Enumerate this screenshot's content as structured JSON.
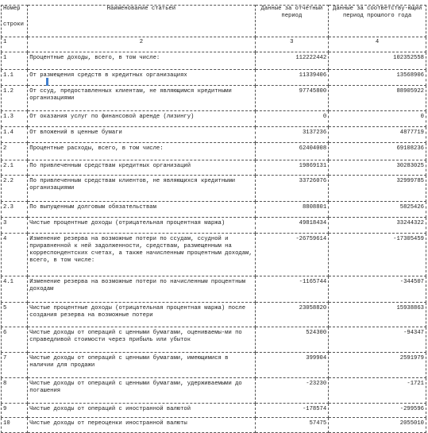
{
  "header": {
    "col1_top": "Номер",
    "col1_bottom": "строки",
    "col2": "Наименование статьей",
    "col3": "Данные за отчетный период",
    "col4": "Данные за соответству-ющий период прошлого года"
  },
  "column_numbers": [
    "1",
    "2",
    "3",
    "4"
  ],
  "rows": [
    {
      "num": "1",
      "name": "Процентные доходы, всего, в том числе:",
      "current": "112222442",
      "previous": "102352558"
    },
    {
      "num": "1.1",
      "name": "От размещения средств в кредитных организациях",
      "current": "11339406",
      "previous": "13568906"
    },
    {
      "num": "1.2",
      "name": "От ссуд, предоставленных клиентам, не являющимся кредитными организациями",
      "current": "97745800",
      "previous": "88905922"
    },
    {
      "num": "1.3",
      "name": "От оказания услуг по финансовой аренде (лизингу)",
      "current": "0",
      "previous": "0"
    },
    {
      "num": "1.4",
      "name": "От вложений в ценные бумаги",
      "current": "3137236",
      "previous": "4877719"
    },
    {
      "num": "2",
      "name": "Процентные расходы, всего, в том числе:",
      "current": "62404008",
      "previous": "69108236"
    },
    {
      "num": "2.1",
      "name": "По привлеченным средствам кредитных организаций",
      "current": "19869131",
      "previous": "30283025"
    },
    {
      "num": "2.2",
      "name": "По привлеченным средствам клиентов, не являющихся кредитными организациями",
      "current": "33726076",
      "previous": "32999785"
    },
    {
      "num": "2.3",
      "name": "По выпущенным долговым обязательствам",
      "current": "8808801",
      "previous": "5825426"
    },
    {
      "num": "3",
      "name": "Чистые процентные доходы (отрицательная процентная маржа)",
      "current": "49818434",
      "previous": "33244322"
    },
    {
      "num": "4",
      "name": "Изменение резерва на возможные потери по ссудам, ссудной и приравненной к ней задолженности, средствам, размещенным на корреспондентских счетах, а также начисленным процентным доходам, всего, в том числе:",
      "current": "-26759614",
      "previous": "-17305459"
    },
    {
      "num": "4.1",
      "name": "Изменение резерва на возможные потери по начисленным процентным доходам",
      "current": "-1165744",
      "previous": "-344507"
    },
    {
      "num": "5",
      "name": "Чистые процентные доходы (отрицательная процентная маржа) после создания резерва на возможные потери",
      "current": "23058820",
      "previous": "15938863"
    },
    {
      "num": "6",
      "name": "Чистые доходы от операций с ценными бумагами, оцениваемы-ми по справедливой стоимости через прибыль или убыток",
      "current": "524300",
      "previous": "-94347"
    },
    {
      "num": "7",
      "name": "Чистые доходы от операций с ценными бумагами, имеющимися в наличии для продажи",
      "current": "399904",
      "previous": "2591979"
    },
    {
      "num": "8",
      "name": "Чистые доходы от операций с ценными бумагами, удерживаемыми до погашения",
      "current": "-23230",
      "previous": "-1721"
    },
    {
      "num": "9",
      "name": "Чистые доходы от операций с иностранной валютой",
      "current": "-178574",
      "previous": "-299596"
    },
    {
      "num": "10",
      "name": "Чистые доходы от переоценки иностранной валюты",
      "current": "57475",
      "previous": "2055010"
    }
  ]
}
